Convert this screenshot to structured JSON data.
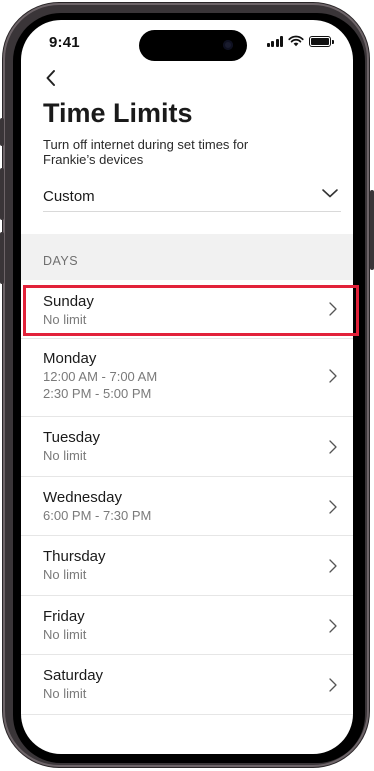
{
  "status_bar": {
    "time": "9:41"
  },
  "header": {
    "title": "Time Limits",
    "subtitle": "Turn off internet during set times for Frankie’s devices"
  },
  "schedule_select": {
    "value": "Custom"
  },
  "section": {
    "label": "DAYS"
  },
  "days": [
    {
      "name": "Sunday",
      "details": [
        "No limit"
      ]
    },
    {
      "name": "Monday",
      "details": [
        "12:00 AM - 7:00 AM",
        "2:30 PM - 5:00 PM"
      ]
    },
    {
      "name": "Tuesday",
      "details": [
        "No limit"
      ]
    },
    {
      "name": "Wednesday",
      "details": [
        "6:00 PM - 7:30 PM"
      ]
    },
    {
      "name": "Thursday",
      "details": [
        "No limit"
      ]
    },
    {
      "name": "Friday",
      "details": [
        "No limit"
      ]
    },
    {
      "name": "Saturday",
      "details": [
        "No limit"
      ]
    }
  ],
  "highlight_color": "#e2223a"
}
